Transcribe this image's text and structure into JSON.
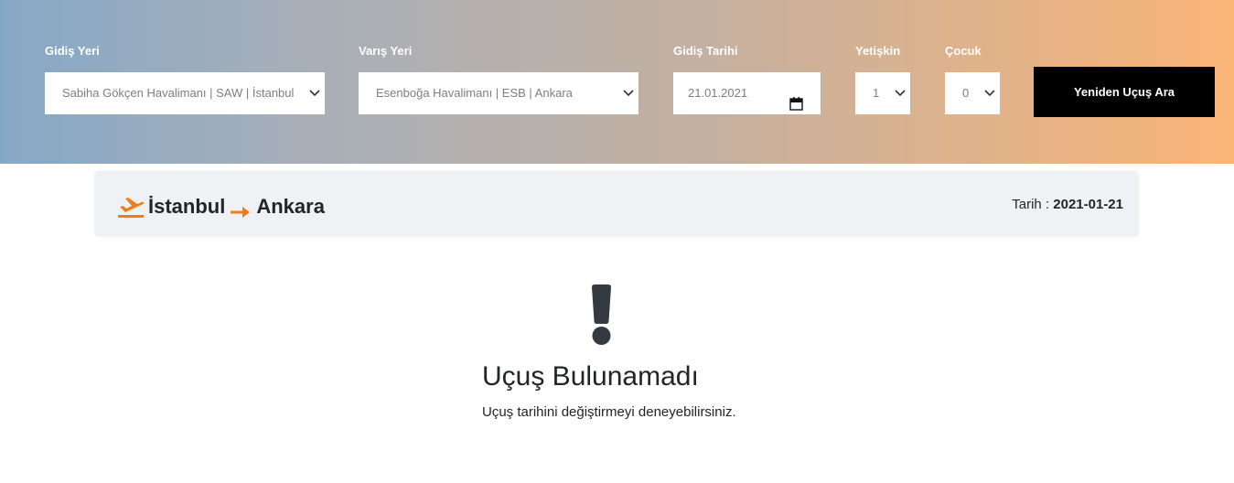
{
  "search": {
    "departure": {
      "label": "Gidiş Yeri",
      "value": "Sabiha Gökçen Havalimanı | SAW | İstanbul"
    },
    "arrival": {
      "label": "Varış Yeri",
      "value": "Esenboğa Havalimanı | ESB | Ankara"
    },
    "date": {
      "label": "Gidiş Tarihi",
      "value": "21.01.2021"
    },
    "adults": {
      "label": "Yetişkin",
      "value": "1"
    },
    "children": {
      "label": "Çocuk",
      "value": "0"
    },
    "submit_label": "Yeniden Uçuş Ara",
    "icons": {
      "select": "chevron-down-icon",
      "date": "calendar-icon"
    }
  },
  "route": {
    "from": "İstanbul",
    "to": "Ankara",
    "date_label": "Tarih :",
    "date_value": "2021-01-21",
    "icons": {
      "plane": "plane-departure-icon",
      "arrow": "arrow-right-icon"
    },
    "accent_color": "#f07d1a"
  },
  "empty_state": {
    "icon": "exclamation-icon",
    "title": "Uçuş Bulunamadı",
    "message": "Uçuş tarihini değiştirmeyi deneyebilirsiniz."
  },
  "colors": {
    "gradient_start": "#86a8c7",
    "gradient_end": "#fbb577",
    "button_bg": "#000000",
    "card_bg": "#f0f1f5"
  }
}
